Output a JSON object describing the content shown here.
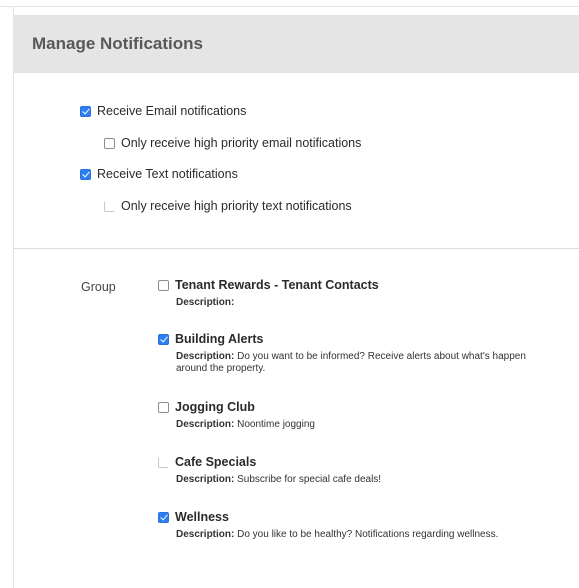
{
  "header": {
    "title": "Manage Notifications"
  },
  "preferences": [
    {
      "label": "Receive Email notifications",
      "checked": true,
      "style": "on"
    },
    {
      "label": "Only receive high priority email notifications",
      "checked": false,
      "style": "off"
    },
    {
      "label": "Receive Text notifications",
      "checked": true,
      "style": "on"
    },
    {
      "label": "Only receive high priority text notifications",
      "checked": false,
      "style": "faint"
    }
  ],
  "groups": {
    "label": "Group",
    "description_label": "Description:",
    "items": [
      {
        "name": "Tenant Rewards - Tenant Contacts",
        "checked": false,
        "style": "off",
        "description": "",
        "description_line2": ""
      },
      {
        "name": "Building Alerts",
        "checked": true,
        "style": "on",
        "description": "Do you want to be informed? Receive alerts about what's happen",
        "description_line2": "around the property."
      },
      {
        "name": "Jogging Club",
        "checked": false,
        "style": "off",
        "description": "Noontime jogging",
        "description_line2": ""
      },
      {
        "name": "Cafe Specials",
        "checked": false,
        "style": "faint",
        "description": "Subscribe for special cafe deals!",
        "description_line2": ""
      },
      {
        "name": "Wellness",
        "checked": true,
        "style": "on",
        "description": "Do you like to be healthy? Notifications regarding wellness.",
        "description_line2": ""
      }
    ]
  },
  "colors": {
    "accent": "#2d7ef3",
    "header_bg": "#e5e5e5",
    "header_text": "#595959"
  }
}
